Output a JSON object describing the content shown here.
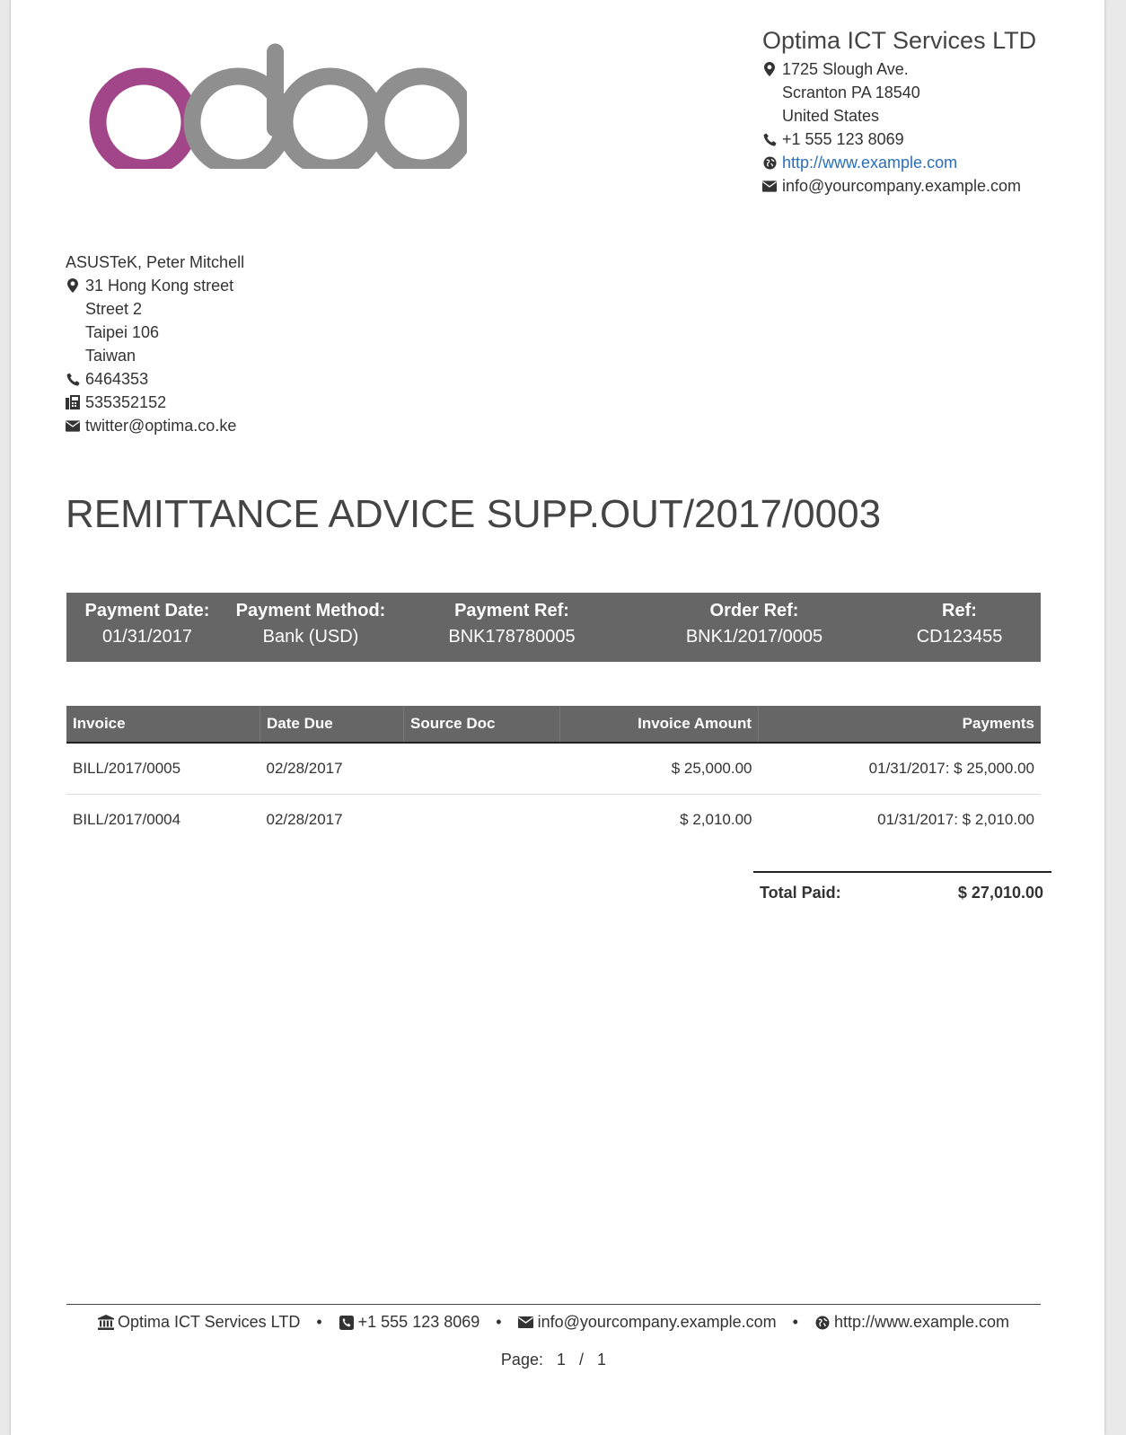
{
  "company": {
    "name": "Optima ICT Services LTD",
    "street": "1725 Slough Ave.",
    "city_line": "Scranton PA 18540",
    "country": "United States",
    "phone": "+1 555 123 8069",
    "website": "http://www.example.com",
    "email": "info@yourcompany.example.com"
  },
  "partner": {
    "name": "ASUSTeK, Peter Mitchell",
    "street": "31 Hong Kong street",
    "street2": "Street 2",
    "city_line": "Taipei 106",
    "country": "Taiwan",
    "phone": "6464353",
    "fax": "535352152",
    "email": "twitter@optima.co.ke"
  },
  "document": {
    "title": "REMITTANCE ADVICE SUPP.OUT/2017/0003"
  },
  "info": [
    {
      "label": "Payment Date:",
      "value": "01/31/2017"
    },
    {
      "label": "Payment Method:",
      "value": "Bank (USD)"
    },
    {
      "label": "Payment Ref:",
      "value": "BNK178780005"
    },
    {
      "label": "Order Ref:",
      "value": "BNK1/2017/0005"
    },
    {
      "label": "Ref:",
      "value": "CD123455"
    }
  ],
  "table": {
    "headers": [
      "Invoice",
      "Date Due",
      "Source Doc",
      "Invoice Amount",
      "Payments"
    ],
    "rows": [
      [
        "BILL/2017/0005",
        "02/28/2017",
        "",
        "$ 25,000.00",
        "01/31/2017: $ 25,000.00"
      ],
      [
        "BILL/2017/0004",
        "02/28/2017",
        "",
        "$ 2,010.00",
        "01/31/2017: $ 2,010.00"
      ]
    ]
  },
  "totals": {
    "label": "Total Paid:",
    "value": "$ 27,010.00"
  },
  "footer": {
    "company": "Optima ICT Services LTD",
    "phone": "+1 555 123 8069",
    "email": "info@yourcompany.example.com",
    "website": "http://www.example.com",
    "separator": "•",
    "page_label": "Page:",
    "page_current": "1",
    "page_sep": "/",
    "page_total": "1"
  },
  "colors": {
    "logo_purple": "#a24689",
    "logo_gray": "#8f8f8f",
    "header_bg": "#666666",
    "link": "#2a6fb8"
  },
  "icons": [
    "map-marker-icon",
    "phone-icon",
    "globe-icon",
    "envelope-icon",
    "fax-icon",
    "bank-icon"
  ]
}
